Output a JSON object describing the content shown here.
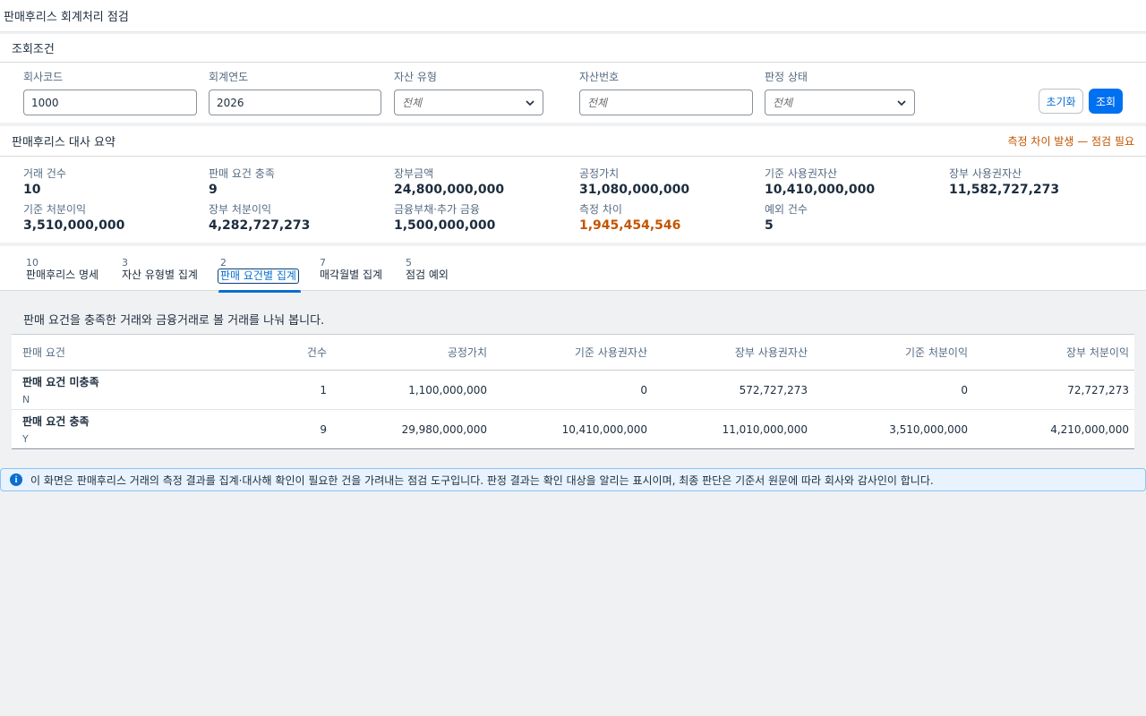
{
  "app": {
    "title": "판매후리스 회계처리 점검"
  },
  "filter": {
    "title": "조회조건",
    "company_code": {
      "label": "회사코드",
      "value": "1000"
    },
    "fiscal_year": {
      "label": "회계연도",
      "value": "2026"
    },
    "asset_type": {
      "label": "자산 유형",
      "value": "전체"
    },
    "asset_number": {
      "label": "자산번호",
      "placeholder": "전체"
    },
    "judgment_status": {
      "label": "판정 상태",
      "value": "전체"
    },
    "reset_label": "초기화",
    "search_label": "조회"
  },
  "summary": {
    "title": "판매후리스 대사 요약",
    "warning": "측정 차이 발생 — 점검 필요",
    "kpis": [
      {
        "label": "거래 건수",
        "value": "10"
      },
      {
        "label": "판매 요건 충족",
        "value": "9"
      },
      {
        "label": "장부금액",
        "value": "24,800,000,000"
      },
      {
        "label": "공정가치",
        "value": "31,080,000,000"
      },
      {
        "label": "기준 사용권자산",
        "value": "10,410,000,000"
      },
      {
        "label": "장부 사용권자산",
        "value": "11,582,727,273"
      },
      {
        "label": "기준 처분이익",
        "value": "3,510,000,000"
      },
      {
        "label": "장부 처분이익",
        "value": "4,282,727,273"
      },
      {
        "label": "금융부채·추가 금융",
        "value": "1,500,000,000"
      },
      {
        "label": "측정 차이",
        "value": "1,945,454,546"
      },
      {
        "label": "예외 건수",
        "value": "5"
      }
    ]
  },
  "tabs": [
    {
      "count": "10",
      "label": "판매후리스 명세"
    },
    {
      "count": "3",
      "label": "자산 유형별 집계"
    },
    {
      "count": "2",
      "label": "판매 요건별 집계"
    },
    {
      "count": "7",
      "label": "매각월별 집계"
    },
    {
      "count": "5",
      "label": "점검 예외"
    }
  ],
  "active_tab": "판매 요건별 집계",
  "description": "판매 요건을 충족한 거래와 금융거래로 볼 거래를 나눠 봅니다.",
  "table": {
    "headers": [
      "판매 요건",
      "건수",
      "공정가치",
      "기준 사용권자산",
      "장부 사용권자산",
      "기준 처분이익",
      "장부 처분이익"
    ],
    "rows": [
      {
        "name": "판매 요건 미충족",
        "code": "N",
        "count": "1",
        "fair_value": "1,100,000,000",
        "base_rou": "0",
        "book_rou": "572,727,273",
        "base_gain": "0",
        "book_gain": "72,727,273"
      },
      {
        "name": "판매 요건 충족",
        "code": "Y",
        "count": "9",
        "fair_value": "29,980,000,000",
        "base_rou": "10,410,000,000",
        "book_rou": "11,010,000,000",
        "base_gain": "3,510,000,000",
        "book_gain": "4,210,000,000"
      }
    ]
  },
  "info": "이 화면은 판매후리스 거래의 측정 결과를 집계·대사해 확인이 필요한 건을 가려내는 점검 도구입니다. 판정 결과는 확인 대상을 알리는 표시이며, 최종 판단은 기준서 원문에 따라 회사와 감사인이 합니다.",
  "colors": {
    "accent": "#0070f2",
    "warning": "#c35500",
    "info_bg": "#e8f3ff"
  }
}
